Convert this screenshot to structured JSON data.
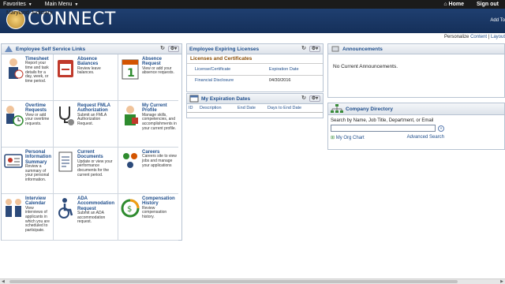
{
  "menubar": {
    "favorites": "Favorites",
    "main_menu": "Main Menu",
    "home": "Home",
    "signout": "Sign out"
  },
  "banner": {
    "title": "CONNECT",
    "subtitle": "Maryland Judiciary",
    "addto": "Add To"
  },
  "personalize": {
    "label": "Personalize",
    "content": "Content",
    "sep": "|",
    "layout": "Layout"
  },
  "ess": {
    "title": "Employee Self Service Links",
    "tiles": [
      {
        "title": "Timesheet",
        "desc": "Report your time and task details for a day, week, or time period.",
        "icon": "timesheet-icon"
      },
      {
        "title": "Absence Balances",
        "desc": "Review leave balances.",
        "icon": "absence-balances-icon"
      },
      {
        "title": "Absence Request",
        "desc": "View or add your absence requests.",
        "icon": "calendar-icon"
      },
      {
        "title": "Overtime Requests",
        "desc": "View or add your overtime requests.",
        "icon": "overtime-clock-icon"
      },
      {
        "title": "Request FMLA Authorization",
        "desc": "Submit an FMLA Authorization Request.",
        "icon": "stethoscope-icon"
      },
      {
        "title": "My Current Profile",
        "desc": "Manage skills, competencies, and accomplishments in your current profile.",
        "icon": "profile-icon"
      },
      {
        "title": "Personal Information Summary",
        "desc": "Review a summary of your personal information.",
        "icon": "id-card-icon"
      },
      {
        "title": "Current Documents",
        "desc": "Update or view your performance documents for the current period.",
        "icon": "document-icon"
      },
      {
        "title": "Careers",
        "desc": "Careers site to view jobs and manage your applications",
        "icon": "careers-icon"
      },
      {
        "title": "Interview Calendar",
        "desc": "View interviews of applicants in which you are scheduled to participate.",
        "icon": "interview-icon"
      },
      {
        "title": "ADA Accommodation Request",
        "desc": "Submit an ADA accommodation request.",
        "icon": "wheelchair-icon"
      },
      {
        "title": "Compensation History",
        "desc": "Review compensation history.",
        "icon": "compensation-icon"
      }
    ]
  },
  "licenses": {
    "title": "Employee Expiring Licenses",
    "subheader": "Licenses and Certificates",
    "columns": [
      "License/Certificate",
      "Expiration Date"
    ],
    "rows": [
      {
        "name": "Financial Disclosure",
        "date": "04/30/2016"
      }
    ]
  },
  "expiration": {
    "title": "My Expiration Dates",
    "columns": [
      "ID",
      "Description",
      "End Date",
      "Days to End Date"
    ]
  },
  "announcements": {
    "title": "Announcements",
    "text": "No Current Announcements."
  },
  "directory": {
    "title": "Company Directory",
    "label": "Search by Name, Job Title, Department, or Email",
    "input_value": "",
    "go": "»",
    "org_chart": "My Org Chart",
    "advanced": "Advanced Search"
  },
  "colors": {
    "banner": "#1f3f70",
    "link": "#1f4e8c",
    "subheader": "#8a4b00"
  }
}
